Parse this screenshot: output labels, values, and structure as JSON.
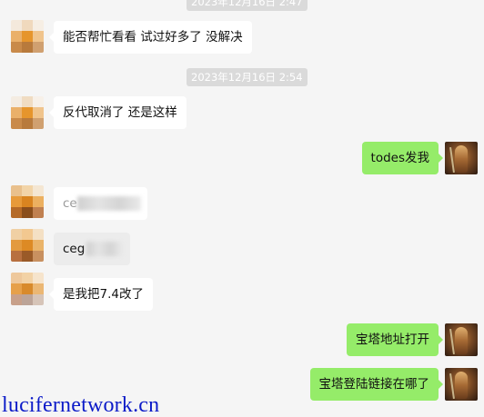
{
  "timestamps": [
    "2023年12月16日 2:47",
    "2023年12月16日 2:54"
  ],
  "messages": [
    {
      "text": "能否帮忙看看 试过好多了 没解决"
    },
    {
      "text": "反代取消了 还是这样"
    },
    {
      "text": "todes发我"
    },
    {
      "text": "ce"
    },
    {
      "text": "ceg"
    },
    {
      "text": "是我把7.4改了"
    },
    {
      "text": "宝塔地址打开"
    },
    {
      "text": "宝塔登陆链接在哪了"
    }
  ],
  "watermark": "lucifernetwork.cn",
  "colors": {
    "background": "#f5f5f5",
    "incoming_bubble": "#ffffff",
    "outgoing_bubble": "#95ec69",
    "timestamp_bg": "#dadada",
    "watermark": "#0c1bc8"
  },
  "icons": [
    "pixelated-avatar-icon",
    "warrior-avatar-icon"
  ]
}
